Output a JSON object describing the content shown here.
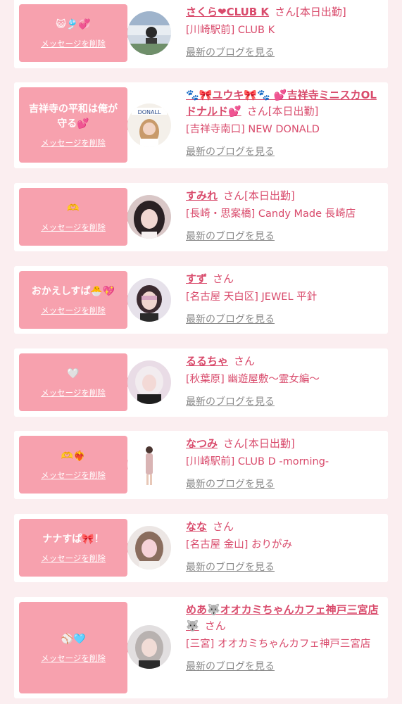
{
  "delete_label": "メッセージを削除",
  "blog_label": "最新のブログを見る",
  "san": "さん",
  "colors": {
    "background": "#fbeef0",
    "bubble": "#f7a1ae",
    "name": "#d94b6c",
    "link": "#8a8a8a"
  },
  "entries": [
    {
      "message": "😺🎐💞",
      "name": "さくら❤CLUB K",
      "status": "[本日出勤]",
      "shop": "[川崎駅前] CLUB K",
      "avatar": "girl-photo"
    },
    {
      "message": "吉祥寺の平和は俺が守る💕",
      "name": "🐾🎀ユウキ🎀🐾 💕吉祥寺ミニスカOLドナルド💕",
      "status": "[本日出勤]",
      "shop": "[吉祥寺南口] NEW DONALD",
      "avatar": "girl-photo"
    },
    {
      "message": "🫶",
      "name": "すみれ",
      "status": "[本日出勤]",
      "shop": "[長崎・思案橋] Candy Made 長崎店",
      "avatar": "girl-photo"
    },
    {
      "message": "おかえしすぱ🐣💖",
      "name": "すず",
      "status": "",
      "shop": "[名古屋 天白区] JEWEL 平針",
      "avatar": "girl-photo"
    },
    {
      "message": "🤍",
      "name": "るるちゃ",
      "status": "",
      "shop": "[秋葉原] 幽遊屋敷〜霊女編〜",
      "avatar": "girl-photo"
    },
    {
      "message": "🫶❤️‍🔥",
      "name": "なつみ",
      "status": "[本日出勤]",
      "shop": "[川崎駅前] CLUB D -morning-",
      "avatar": "girl-photo"
    },
    {
      "message": "ナナすぱ🎀！",
      "name": "なな",
      "status": "",
      "shop": "[名古屋 金山] おりがみ",
      "avatar": "girl-photo"
    },
    {
      "message": "⚾🩵",
      "name": "めあ🐺オオカミちゃんカフェ神戸三宮店🐺",
      "status": "",
      "shop": "[三宮] オオカミちゃんカフェ神戸三宮店",
      "avatar": "girl-photo"
    }
  ]
}
